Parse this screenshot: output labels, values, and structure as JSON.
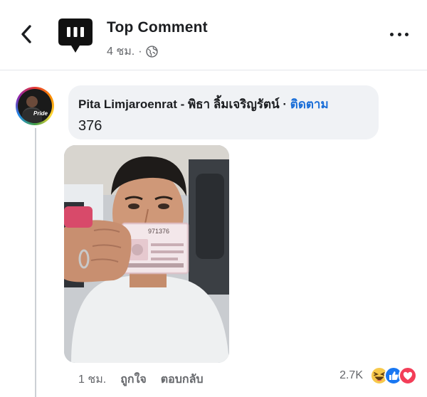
{
  "header": {
    "title": "Top Comment",
    "time": "4 ชม.",
    "dot": "·",
    "icons": {
      "back": "chevron-left-icon",
      "globe": "globe-icon",
      "more": "more-horizontal-icon",
      "logo": "chat-bubble-logo"
    }
  },
  "comment": {
    "author": "Pita Limjaroenrat - พิธา ลิ้มเจริญรัตน์",
    "separator": "·",
    "follow_label": "ติดตาม",
    "text": "376",
    "avatar_badge": "Pride"
  },
  "actions": {
    "time": "1 ชม.",
    "like_label": "ถูกใจ",
    "reply_label": "ตอบกลับ"
  },
  "reactions": {
    "count": "2.7K",
    "types": [
      "haha-icon",
      "like-icon",
      "love-icon"
    ]
  },
  "colors": {
    "accent_blue": "#1a6ed8",
    "bubble_bg": "#f0f2f5",
    "secondary_text": "#65676b"
  }
}
